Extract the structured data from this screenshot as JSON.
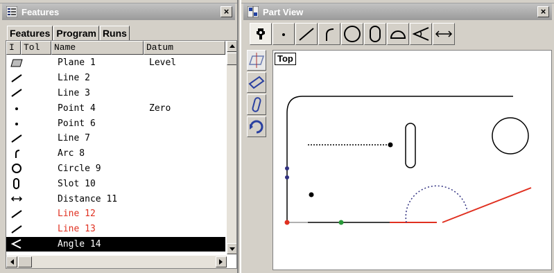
{
  "features_window": {
    "title": "Features",
    "close": "×",
    "tabs": [
      "Features",
      "Program",
      "Runs"
    ],
    "columns": [
      "I",
      "Tol",
      "Name",
      "Datum"
    ],
    "rows": [
      {
        "icon": "plane-icon",
        "name": "Plane 1",
        "datum": "Level",
        "color": "#000000"
      },
      {
        "icon": "line-icon",
        "name": "Line 2",
        "datum": "",
        "color": "#000000"
      },
      {
        "icon": "line-icon",
        "name": "Line 3",
        "datum": "",
        "color": "#000000"
      },
      {
        "icon": "point-icon",
        "name": "Point 4",
        "datum": "Zero",
        "color": "#000000"
      },
      {
        "icon": "point-icon",
        "name": "Point 6",
        "datum": "",
        "color": "#000000"
      },
      {
        "icon": "line-icon",
        "name": "Line 7",
        "datum": "",
        "color": "#000000"
      },
      {
        "icon": "arc-icon",
        "name": "Arc 8",
        "datum": "",
        "color": "#000000"
      },
      {
        "icon": "circle-icon",
        "name": "Circle 9",
        "datum": "",
        "color": "#000000"
      },
      {
        "icon": "slot-icon",
        "name": "Slot 10",
        "datum": "",
        "color": "#000000"
      },
      {
        "icon": "distance-icon",
        "name": "Distance 11",
        "datum": "",
        "color": "#000000"
      },
      {
        "icon": "line-icon",
        "name": "Line 12",
        "datum": "",
        "color": "#e03020"
      },
      {
        "icon": "line-icon",
        "name": "Line 13",
        "datum": "",
        "color": "#e03020"
      },
      {
        "icon": "angle-icon",
        "name": "Angle 14",
        "datum": "",
        "color": "#ffffff",
        "selected": true
      }
    ]
  },
  "part_view_window": {
    "title": "Part View",
    "close": "×",
    "toolbar": [
      "probe-icon",
      "point-icon",
      "line-icon",
      "arc-icon",
      "circle-icon",
      "slot-icon",
      "semicircle-icon",
      "angle-icon",
      "distance-icon"
    ],
    "side_tools": [
      "plane-view-icon",
      "rectangle-view-icon",
      "rotate-view-icon",
      "refresh-view-icon"
    ],
    "view_label": "Top"
  },
  "colors": {
    "title_bar": "#a8a8a8",
    "red_feature": "#e03020",
    "selected_row": "#000000",
    "blue_dots": "#303080",
    "green_dot": "#2a9a3a"
  }
}
